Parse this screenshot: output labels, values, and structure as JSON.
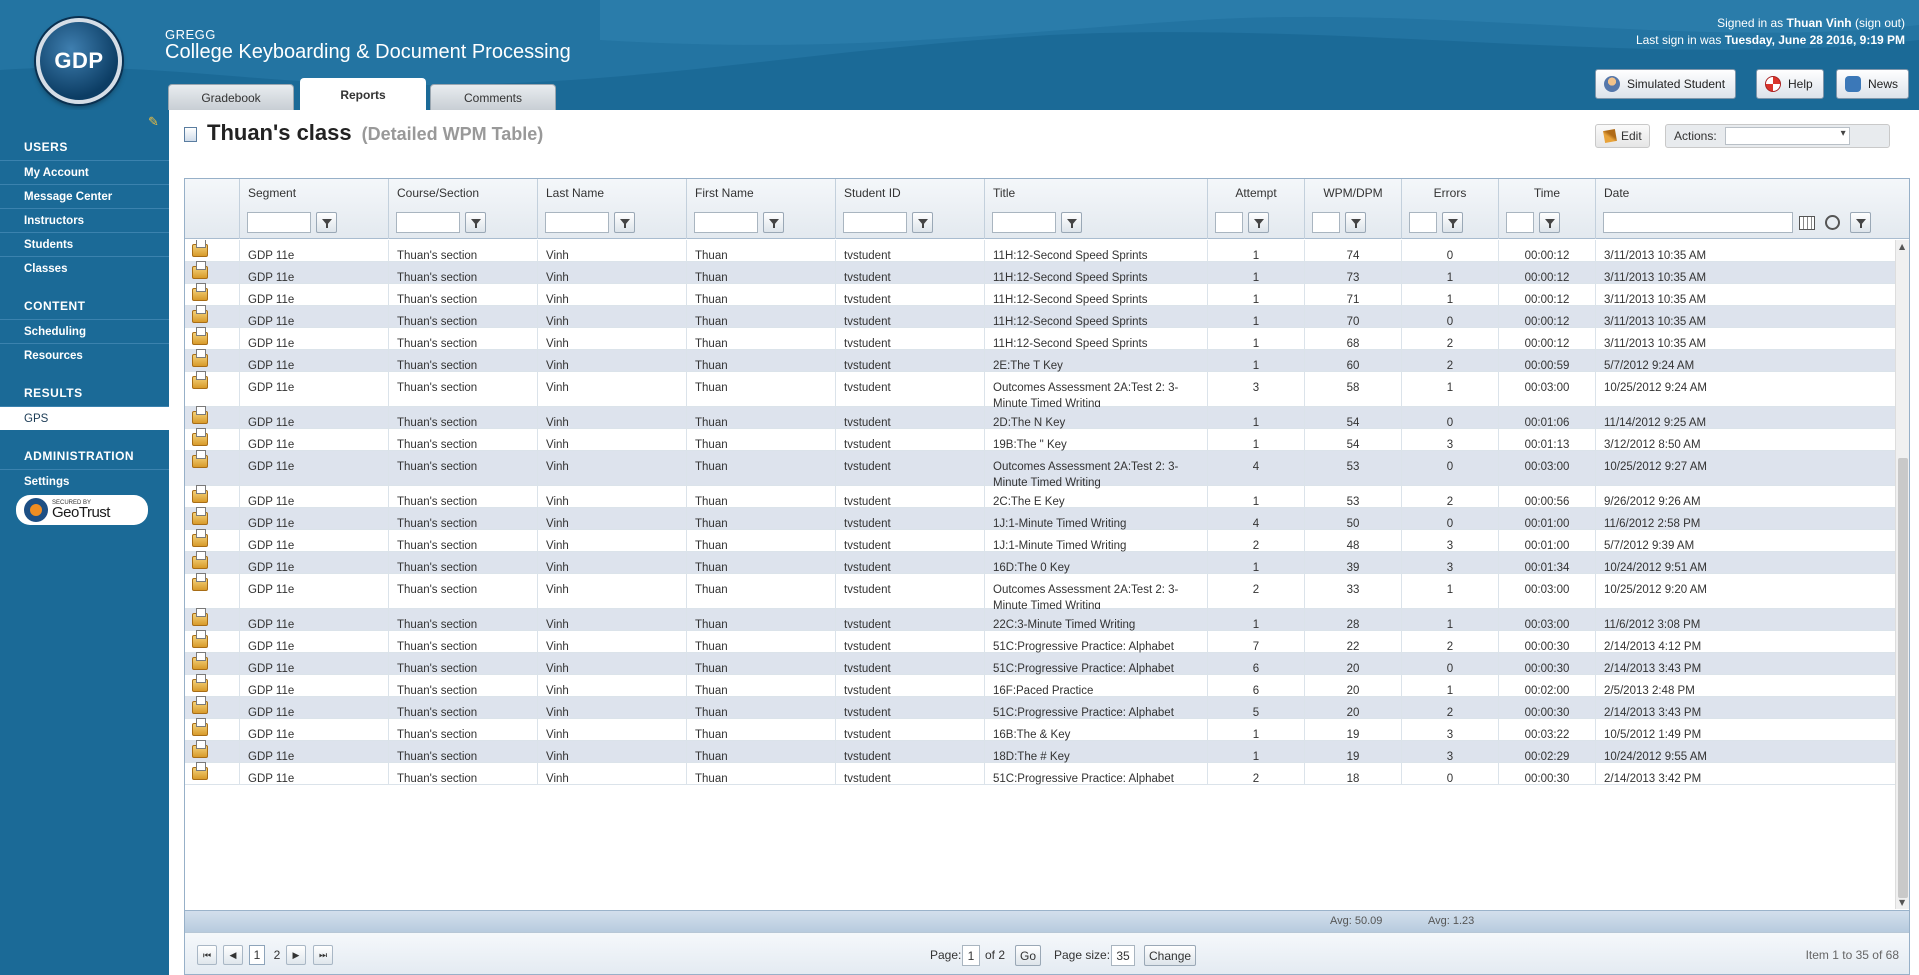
{
  "header": {
    "logo_text": "GDP",
    "brand_small": "GREGG",
    "brand_title": "College Keyboarding & Document Processing",
    "signed_in_prefix": "Signed in as",
    "user_name": "Thuan Vinh",
    "sign_out": "(sign out)",
    "last_sign_in_prefix": "Last sign in was",
    "last_sign_in": "Tuesday, June 28 2016, 9:19 PM",
    "tabs": [
      {
        "label": "Gradebook"
      },
      {
        "label": "Reports"
      },
      {
        "label": "Comments"
      }
    ],
    "buttons": {
      "simulated_student": "Simulated Student",
      "help": "Help",
      "news": "News"
    }
  },
  "sidebar": {
    "sections": [
      {
        "label": "USERS",
        "items": [
          "My Account",
          "Message Center",
          "Instructors",
          "Students",
          "Classes"
        ]
      },
      {
        "label": "CONTENT",
        "items": [
          "Scheduling",
          "Resources"
        ]
      },
      {
        "label": "RESULTS",
        "items": [
          "GPS"
        ]
      },
      {
        "label": "ADMINISTRATION",
        "items": [
          "Settings"
        ]
      }
    ],
    "geotrust_secured": "SECURED BY",
    "geotrust_name": "GeoTrust"
  },
  "page": {
    "title": "Thuan's class",
    "subtitle": "(Detailed WPM Table)",
    "edit_label": "Edit",
    "actions_label": "Actions:"
  },
  "grid": {
    "columns": [
      "Segment",
      "Course/Section",
      "Last Name",
      "First Name",
      "Student ID",
      "Title",
      "Attempt",
      "WPM/DPM",
      "Errors",
      "Time",
      "Date"
    ],
    "rows": [
      [
        "GDP 11e",
        "Thuan's section",
        "Vinh",
        "Thuan",
        "tvstudent",
        "11H:12-Second Speed Sprints",
        "1",
        "74",
        "0",
        "00:00:12",
        "3/11/2013 10:35 AM"
      ],
      [
        "GDP 11e",
        "Thuan's section",
        "Vinh",
        "Thuan",
        "tvstudent",
        "11H:12-Second Speed Sprints",
        "1",
        "73",
        "1",
        "00:00:12",
        "3/11/2013 10:35 AM"
      ],
      [
        "GDP 11e",
        "Thuan's section",
        "Vinh",
        "Thuan",
        "tvstudent",
        "11H:12-Second Speed Sprints",
        "1",
        "71",
        "1",
        "00:00:12",
        "3/11/2013 10:35 AM"
      ],
      [
        "GDP 11e",
        "Thuan's section",
        "Vinh",
        "Thuan",
        "tvstudent",
        "11H:12-Second Speed Sprints",
        "1",
        "70",
        "0",
        "00:00:12",
        "3/11/2013 10:35 AM"
      ],
      [
        "GDP 11e",
        "Thuan's section",
        "Vinh",
        "Thuan",
        "tvstudent",
        "11H:12-Second Speed Sprints",
        "1",
        "68",
        "2",
        "00:00:12",
        "3/11/2013 10:35 AM"
      ],
      [
        "GDP 11e",
        "Thuan's section",
        "Vinh",
        "Thuan",
        "tvstudent",
        "2E:The T Key",
        "1",
        "60",
        "2",
        "00:00:59",
        "5/7/2012 9:24 AM"
      ],
      [
        "GDP 11e",
        "Thuan's section",
        "Vinh",
        "Thuan",
        "tvstudent",
        "Outcomes Assessment 2A:Test 2: 3-Minute Timed Writing",
        "3",
        "58",
        "1",
        "00:03:00",
        "10/25/2012 9:24 AM"
      ],
      [
        "GDP 11e",
        "Thuan's section",
        "Vinh",
        "Thuan",
        "tvstudent",
        "2D:The N Key",
        "1",
        "54",
        "0",
        "00:01:06",
        "11/14/2012 9:25 AM"
      ],
      [
        "GDP 11e",
        "Thuan's section",
        "Vinh",
        "Thuan",
        "tvstudent",
        "19B:The \" Key",
        "1",
        "54",
        "3",
        "00:01:13",
        "3/12/2012 8:50 AM"
      ],
      [
        "GDP 11e",
        "Thuan's section",
        "Vinh",
        "Thuan",
        "tvstudent",
        "Outcomes Assessment 2A:Test 2: 3-Minute Timed Writing",
        "4",
        "53",
        "0",
        "00:03:00",
        "10/25/2012 9:27 AM"
      ],
      [
        "GDP 11e",
        "Thuan's section",
        "Vinh",
        "Thuan",
        "tvstudent",
        "2C:The E Key",
        "1",
        "53",
        "2",
        "00:00:56",
        "9/26/2012 9:26 AM"
      ],
      [
        "GDP 11e",
        "Thuan's section",
        "Vinh",
        "Thuan",
        "tvstudent",
        "1J:1-Minute Timed Writing",
        "4",
        "50",
        "0",
        "00:01:00",
        "11/6/2012 2:58 PM"
      ],
      [
        "GDP 11e",
        "Thuan's section",
        "Vinh",
        "Thuan",
        "tvstudent",
        "1J:1-Minute Timed Writing",
        "2",
        "48",
        "3",
        "00:01:00",
        "5/7/2012 9:39 AM"
      ],
      [
        "GDP 11e",
        "Thuan's section",
        "Vinh",
        "Thuan",
        "tvstudent",
        "16D:The 0 Key",
        "1",
        "39",
        "3",
        "00:01:34",
        "10/24/2012 9:51 AM"
      ],
      [
        "GDP 11e",
        "Thuan's section",
        "Vinh",
        "Thuan",
        "tvstudent",
        "Outcomes Assessment 2A:Test 2: 3-Minute Timed Writing",
        "2",
        "33",
        "1",
        "00:03:00",
        "10/25/2012 9:20 AM"
      ],
      [
        "GDP 11e",
        "Thuan's section",
        "Vinh",
        "Thuan",
        "tvstudent",
        "22C:3-Minute Timed Writing",
        "1",
        "28",
        "1",
        "00:03:00",
        "11/6/2012 3:08 PM"
      ],
      [
        "GDP 11e",
        "Thuan's section",
        "Vinh",
        "Thuan",
        "tvstudent",
        "51C:Progressive Practice: Alphabet",
        "7",
        "22",
        "2",
        "00:00:30",
        "2/14/2013 4:12 PM"
      ],
      [
        "GDP 11e",
        "Thuan's section",
        "Vinh",
        "Thuan",
        "tvstudent",
        "51C:Progressive Practice: Alphabet",
        "6",
        "20",
        "0",
        "00:00:30",
        "2/14/2013 3:43 PM"
      ],
      [
        "GDP 11e",
        "Thuan's section",
        "Vinh",
        "Thuan",
        "tvstudent",
        "16F:Paced Practice",
        "6",
        "20",
        "1",
        "00:02:00",
        "2/5/2013 2:48 PM"
      ],
      [
        "GDP 11e",
        "Thuan's section",
        "Vinh",
        "Thuan",
        "tvstudent",
        "51C:Progressive Practice: Alphabet",
        "5",
        "20",
        "2",
        "00:00:30",
        "2/14/2013 3:43 PM"
      ],
      [
        "GDP 11e",
        "Thuan's section",
        "Vinh",
        "Thuan",
        "tvstudent",
        "16B:The & Key",
        "1",
        "19",
        "3",
        "00:03:22",
        "10/5/2012 1:49 PM"
      ],
      [
        "GDP 11e",
        "Thuan's section",
        "Vinh",
        "Thuan",
        "tvstudent",
        "18D:The # Key",
        "1",
        "19",
        "3",
        "00:02:29",
        "10/24/2012 9:55 AM"
      ],
      [
        "GDP 11e",
        "Thuan's section",
        "Vinh",
        "Thuan",
        "tvstudent",
        "51C:Progressive Practice: Alphabet",
        "2",
        "18",
        "0",
        "00:00:30",
        "2/14/2013 3:42 PM"
      ]
    ],
    "footer": {
      "avg_wpm": "Avg: 50.09",
      "avg_errors": "Avg: 1.23"
    }
  },
  "pager": {
    "pages": [
      "1",
      "2"
    ],
    "current_page": "1",
    "page_label": "Page:",
    "page_value": "1",
    "of_label": "of 2",
    "go_label": "Go",
    "size_label": "Page size:",
    "size_value": "35",
    "change_label": "Change",
    "item_summary": "Item 1 to 35 of 68"
  },
  "colors": {
    "header_blue": "#1b6a97",
    "row_alt": "#dde3ed"
  }
}
